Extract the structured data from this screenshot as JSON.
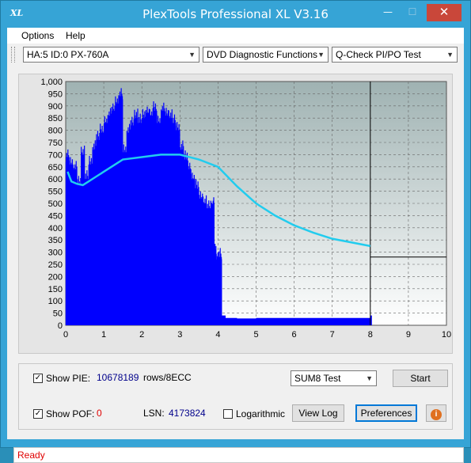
{
  "window": {
    "title": "PlexTools Professional XL V3.16",
    "app_icon_text": "XL",
    "minimize_glyph": "—",
    "maximize_glyph": "☐",
    "close_glyph": "✕"
  },
  "menu": {
    "items": [
      "Options",
      "Help"
    ]
  },
  "toolbar": {
    "drive": "HA:5 ID:0  PX-760A",
    "function": "DVD Diagnostic Functions",
    "test": "Q-Check PI/PO Test"
  },
  "chart_data": {
    "type": "area",
    "x_ticks": [
      "0",
      "1",
      "2",
      "3",
      "4",
      "5",
      "6",
      "7",
      "8",
      "9",
      "10"
    ],
    "y_ticks": [
      "0",
      "50",
      "100",
      "150",
      "200",
      "250",
      "300",
      "350",
      "400",
      "450",
      "500",
      "550",
      "600",
      "650",
      "700",
      "750",
      "800",
      "850",
      "900",
      "950",
      "1,000"
    ],
    "xlim": [
      0,
      10
    ],
    "ylim": [
      0,
      1000
    ],
    "marker_x": 8,
    "marker_y": 280,
    "series": [
      {
        "kind": "bars",
        "color": "#0000ff",
        "x": [
          0,
          0.1,
          0.2,
          0.3,
          0.4,
          0.5,
          0.6,
          0.7,
          0.8,
          0.9,
          1.0,
          1.1,
          1.2,
          1.3,
          1.4,
          1.5,
          1.6,
          1.7,
          1.8,
          1.9,
          2.0,
          2.1,
          2.2,
          2.3,
          2.4,
          2.5,
          2.6,
          2.7,
          2.8,
          2.9,
          3.0,
          3.1,
          3.2,
          3.3,
          3.4,
          3.5,
          3.6,
          3.7,
          3.8,
          3.85,
          3.9,
          3.95,
          4.0,
          4.1,
          4.2,
          4.5,
          5.0,
          5.5,
          6.0,
          6.5,
          7.0,
          7.5,
          7.9,
          8.0
        ],
        "y": [
          690,
          660,
          640,
          580,
          700,
          600,
          660,
          720,
          760,
          790,
          830,
          860,
          880,
          910,
          940,
          710,
          790,
          820,
          850,
          830,
          850,
          870,
          860,
          880,
          830,
          880,
          860,
          850,
          830,
          800,
          720,
          680,
          640,
          600,
          560,
          520,
          500,
          480,
          480,
          490,
          300,
          260,
          280,
          40,
          30,
          28,
          30,
          30,
          30,
          30,
          30,
          30,
          30,
          40
        ]
      },
      {
        "kind": "line",
        "color": "#22ccee",
        "x": [
          0.05,
          0.15,
          0.3,
          0.45,
          0.6,
          0.8,
          1.0,
          1.2,
          1.5,
          2.0,
          2.5,
          3.0,
          3.5,
          4.0,
          4.5,
          5.0,
          5.5,
          6.0,
          6.5,
          7.0,
          7.5,
          8.0
        ],
        "y": [
          630,
          590,
          580,
          575,
          590,
          610,
          630,
          650,
          680,
          690,
          700,
          700,
          680,
          650,
          570,
          500,
          450,
          410,
          380,
          355,
          340,
          325
        ]
      }
    ]
  },
  "options": {
    "show_pie_label": "Show PIE:",
    "pie_value": "10678189",
    "pie_unit": "rows/8ECC",
    "show_poe_label": "Show POF:",
    "poe_value": "0",
    "lsn_label": "LSN:",
    "lsn_value": "4173824",
    "logarithmic_label": "Logarithmic",
    "sum_select": "SUM8 Test",
    "start_button": "Start",
    "viewlog_button": "View Log",
    "preferences_button": "Preferences",
    "info_glyph": "i"
  },
  "status": {
    "text": "Ready"
  }
}
